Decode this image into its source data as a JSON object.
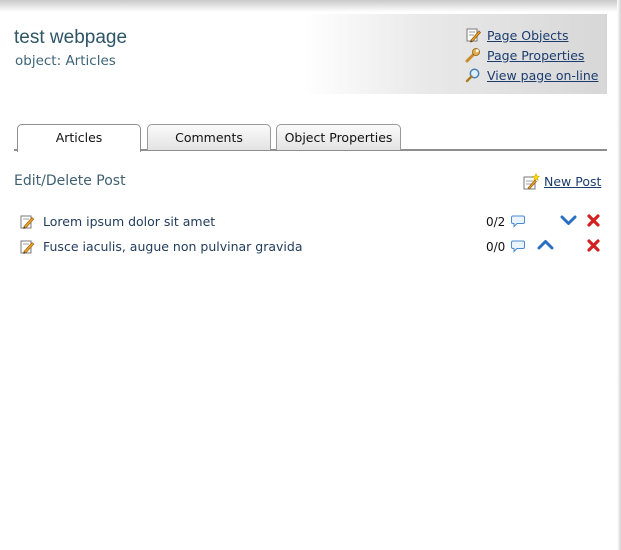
{
  "header": {
    "site_title": "test webpage",
    "object_label": "object: Articles",
    "links": [
      {
        "label": "Page Objects",
        "icon": "pencil-icon"
      },
      {
        "label": "Page Properties",
        "icon": "wrench-icon"
      },
      {
        "label": "View page on-line",
        "icon": "magnifier-icon"
      }
    ]
  },
  "tabs": [
    {
      "label": "Articles",
      "active": true
    },
    {
      "label": "Comments",
      "active": false
    },
    {
      "label": "Object Properties",
      "active": false
    }
  ],
  "main": {
    "section_title": "Edit/Delete Post",
    "new_post_label": "New Post",
    "posts": [
      {
        "title": "Lorem ipsum dolor sit amet",
        "comments": "0/2",
        "move": "move-down"
      },
      {
        "title": "Fusce iaculis, augue non pulvinar gravida",
        "comments": "0/0",
        "move": "move-up"
      }
    ]
  },
  "colors": {
    "link": "#1b3c6e",
    "title": "#2d5566",
    "move_arrow": "#2a6fc4",
    "delete": "#d42020"
  }
}
